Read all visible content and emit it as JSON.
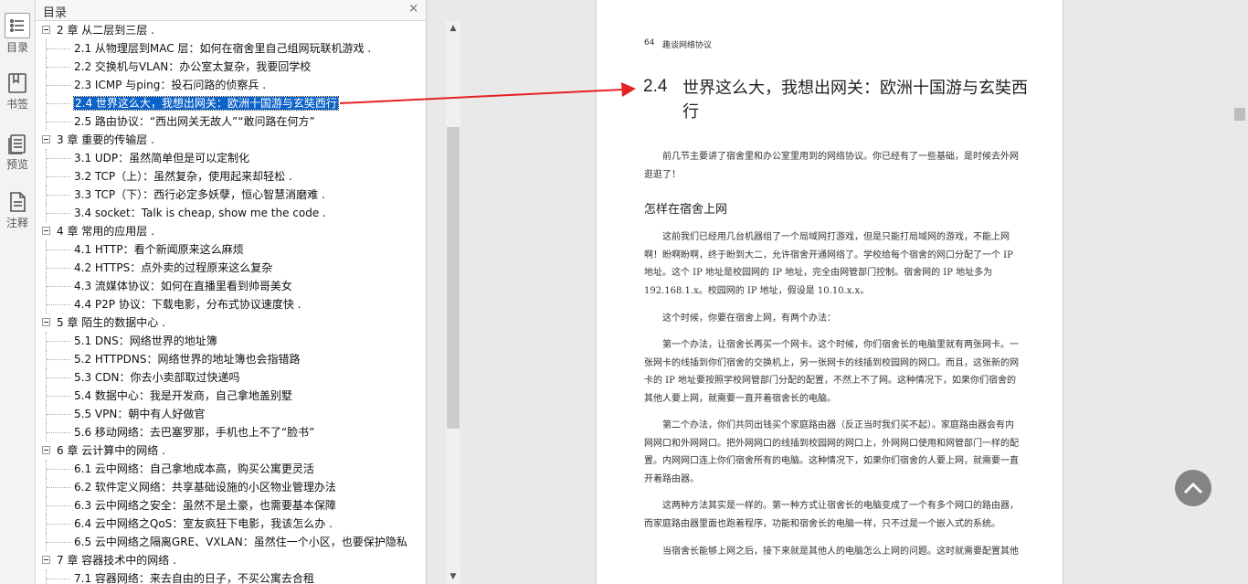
{
  "rail": {
    "items": [
      {
        "label": "目录",
        "icon": "list-icon"
      },
      {
        "label": "书签",
        "icon": "bookmark-icon"
      },
      {
        "label": "预览",
        "icon": "preview-icon"
      },
      {
        "label": "注释",
        "icon": "note-icon"
      }
    ]
  },
  "toc": {
    "title": "目录",
    "close": "×",
    "rows": [
      {
        "level": "ch",
        "text": "2 章 从二层到三层 ."
      },
      {
        "level": "sec",
        "text": "2.1 从物理层到MAC 层：如何在宿舍里自己组网玩联机游戏 ."
      },
      {
        "level": "sec",
        "text": "2.2 交换机与VLAN：办公室太复杂，我要回学校"
      },
      {
        "level": "sec",
        "text": "2.3 ICMP 与ping：投石问路的侦察兵 ."
      },
      {
        "level": "sec",
        "text": "2.4 世界这么大，我想出网关：欧洲十国游与玄奘西行",
        "selected": true
      },
      {
        "level": "sec",
        "text": "2.5 路由协议：“西出网关无故人”“敢问路在何方”"
      },
      {
        "level": "ch",
        "text": "3 章 重要的传输层 ."
      },
      {
        "level": "sec",
        "text": "3.1 UDP：虽然简单但是可以定制化"
      },
      {
        "level": "sec",
        "text": "3.2 TCP（上）：虽然复杂，使用起来却轻松 ."
      },
      {
        "level": "sec",
        "text": "3.3 TCP（下）：西行必定多妖孽，恒心智慧消磨难 ."
      },
      {
        "level": "sec",
        "text": "3.4 socket：Talk is cheap, show me the code ."
      },
      {
        "level": "ch",
        "text": "4 章 常用的应用层 ."
      },
      {
        "level": "sec",
        "text": "4.1 HTTP：看个新闻原来这么麻烦"
      },
      {
        "level": "sec",
        "text": "4.2 HTTPS：点外卖的过程原来这么复杂"
      },
      {
        "level": "sec",
        "text": "4.3 流媒体协议：如何在直播里看到帅哥美女"
      },
      {
        "level": "sec",
        "text": "4.4 P2P 协议：下载电影，分布式协议速度快 ."
      },
      {
        "level": "ch",
        "text": "5 章 陌生的数据中心 ."
      },
      {
        "level": "sec",
        "text": "5.1 DNS：网络世界的地址簿"
      },
      {
        "level": "sec",
        "text": "5.2 HTTPDNS：网络世界的地址簿也会指错路"
      },
      {
        "level": "sec",
        "text": "5.3 CDN：你去小卖部取过快递吗"
      },
      {
        "level": "sec",
        "text": "5.4 数据中心：我是开发商，自己拿地盖别墅"
      },
      {
        "level": "sec",
        "text": "5.5 VPN：朝中有人好做官"
      },
      {
        "level": "sec",
        "text": "5.6 移动网络：去巴塞罗那，手机也上不了“脸书”"
      },
      {
        "level": "ch",
        "text": "6 章 云计算中的网络 ."
      },
      {
        "level": "sec",
        "text": "6.1 云中网络：自己拿地成本高，购买公寓更灵活"
      },
      {
        "level": "sec",
        "text": "6.2 软件定义网络：共享基础设施的小区物业管理办法"
      },
      {
        "level": "sec",
        "text": "6.3 云中网络之安全：虽然不是土豪，也需要基本保障"
      },
      {
        "level": "sec",
        "text": "6.4 云中网络之QoS：室友疯狂下电影，我该怎么办 ."
      },
      {
        "level": "sec",
        "text": "6.5 云中网络之隔离GRE、VXLAN：虽然住一个小区，也要保护隐私"
      },
      {
        "level": "ch",
        "text": "7 章 容器技术中的网络 ."
      },
      {
        "level": "sec",
        "text": "7.1 容器网络：来去自由的日子，不买公寓去合租"
      }
    ]
  },
  "page": {
    "number": "64",
    "header": "趣谈网络协议",
    "section_no": "2.4",
    "section_title": "世界这么大，我想出网关：欧洲十国游与玄奘西行",
    "intro": "前几节主要讲了宿舍里和办公室里用到的网络协议。你已经有了一些基础，是时候去外网逛逛了！",
    "subheading": "怎样在宿舍上网",
    "paragraphs": [
      "这前我们已经用几台机器组了一个局域网打游戏，但是只能打局域网的游戏，不能上网啊！盼啊盼啊，终于盼到大二，允许宿舍开通网络了。学校给每个宿舍的网口分配了一个 IP 地址。这个 IP 地址是校园网的 IP 地址，完全由网管部门控制。宿舍网的 IP 地址多为 192.168.1.x。校园网的 IP 地址，假设是 10.10.x.x。",
      "这个时候，你要在宿舍上网，有两个办法：",
      "第一个办法，让宿舍长再买一个网卡。这个时候，你们宿舍长的电脑里就有两张网卡。一张网卡的线插到你们宿舍的交换机上，另一张网卡的线插到校园网的网口。而且，这张新的网卡的 IP 地址要按照学校网管部门分配的配置，不然上不了网。这种情况下，如果你们宿舍的其他人要上网，就需要一直开着宿舍长的电脑。",
      "第二个办法，你们共同出钱买个家庭路由器（反正当时我们买不起）。家庭路由器会有内网网口和外网网口。把外网网口的线插到校园网的网口上，外网网口使用和网管部门一样的配置。内网网口连上你们宿舍所有的电脑。这种情况下，如果你们宿舍的人要上网，就需要一直开着路由器。",
      "这两种方法其实是一样的。第一种方式让宿舍长的电脑变成了一个有多个网口的路由器，而家庭路由器里面也跑着程序，功能和宿舍长的电脑一样，只不过是一个嵌入式的系统。",
      "当宿舍长能够上网之后，接下来就是其他人的电脑怎么上网的问题。这时就需要配置其他"
    ]
  }
}
